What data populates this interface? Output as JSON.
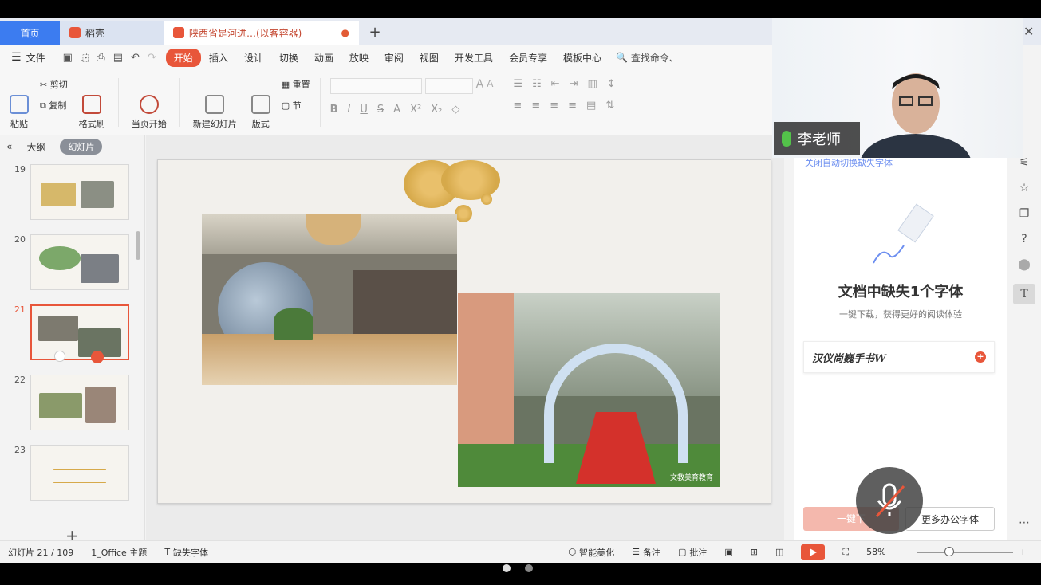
{
  "tabs": {
    "home": "首页",
    "docer": "稻壳",
    "document": "陕西省是河进…(以客容器)",
    "add": "+"
  },
  "menu": {
    "file": "文件",
    "items": [
      "开始",
      "插入",
      "设计",
      "切换",
      "动画",
      "放映",
      "审阅",
      "视图",
      "开发工具",
      "会员专享",
      "模板中心"
    ],
    "search": "查找命令、"
  },
  "ribbon": {
    "paste": "粘贴",
    "cut": "剪切",
    "copy": "复制",
    "format_painter": "格式刷",
    "from_current": "当页开始",
    "new_slide": "新建幻灯片",
    "layout": "版式",
    "reset": "重置",
    "section": "节"
  },
  "left_panel": {
    "outline_tab": "大纲",
    "slides_tab": "幻灯片",
    "slide_numbers": [
      "19",
      "20",
      "21",
      "22",
      "23"
    ],
    "add": "+"
  },
  "right_panel": {
    "link_text": "关闭自动切换缺失字体",
    "title": "文档中缺失1个字体",
    "subtitle": "一键下载，获得更好的阅读体验",
    "font_name": "汉仪尚巍手书W",
    "one_click": "一键下",
    "more_fonts": "更多办公字体"
  },
  "video": {
    "speaker": "李老师"
  },
  "status": {
    "slide_info": "幻灯片 21 / 109",
    "theme": "1_Office 主题",
    "missing_font": "缺失字体",
    "beautify": "智能美化",
    "notes": "备注",
    "comments": "批注",
    "zoom": "58%"
  },
  "photo_watermark": "文教美育教育"
}
